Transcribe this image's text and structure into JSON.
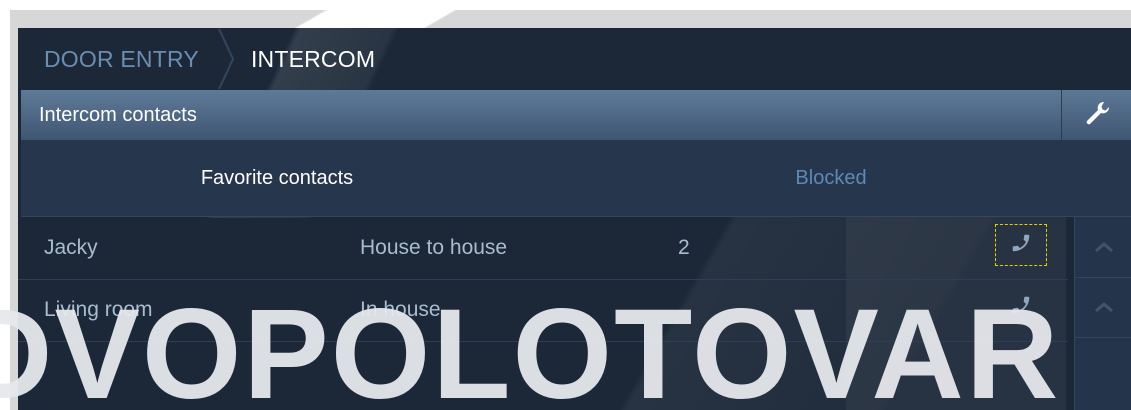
{
  "breadcrumb": {
    "items": [
      "DOOR ENTRY",
      "INTERCOM"
    ],
    "active_color": "#ffffff",
    "inactive_color": "#6a8db0"
  },
  "section": {
    "title": "Intercom contacts",
    "settings_icon": "wrench-icon"
  },
  "tabs": [
    {
      "label": "Favorite contacts",
      "selected": true
    },
    {
      "label": "Blocked",
      "selected": false
    }
  ],
  "contacts": [
    {
      "name": "Jacky",
      "type": "House to house",
      "number": "2",
      "action_icon": "phone-icon",
      "focused": true
    },
    {
      "name": "Living room",
      "type": "In house",
      "number": "",
      "action_icon": "phone-icon",
      "focused": false
    }
  ],
  "scrollbar": {
    "up_icons": [
      "chevron-up-icon",
      "chevron-up-icon"
    ]
  },
  "watermark": "DVOPOLOTOVAR",
  "colors": {
    "screen_bg": "#1c2838",
    "header_bar": "#4d6786",
    "focus_outline": "#e6d200",
    "tab_inactive": "#5f88b6"
  }
}
